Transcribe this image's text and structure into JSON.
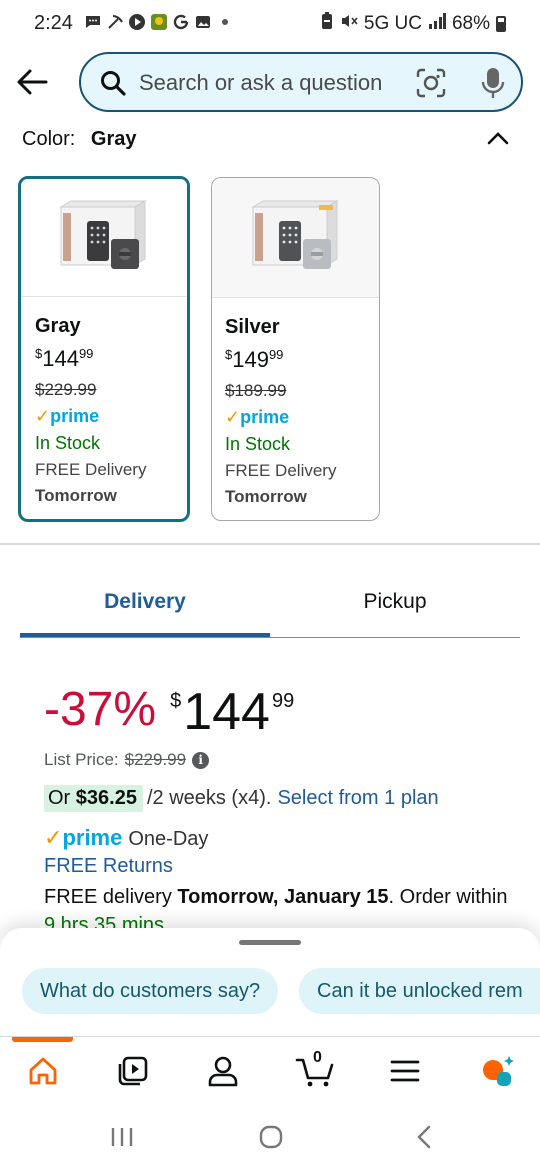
{
  "status_bar": {
    "time": "2:24",
    "network": "5G UC",
    "battery": "68%"
  },
  "search": {
    "placeholder": "Search or ask a question"
  },
  "color_selector": {
    "label": "Color:",
    "value": "Gray"
  },
  "swatches": [
    {
      "name": "Gray",
      "price_symbol": "$",
      "price_whole": "144",
      "price_fraction": "99",
      "list_price": "$229.99",
      "prime": "prime",
      "stock": "In Stock",
      "delivery": "FREE Delivery",
      "delivery_day": "Tomorrow"
    },
    {
      "name": "Silver",
      "price_symbol": "$",
      "price_whole": "149",
      "price_fraction": "99",
      "list_price": "$189.99",
      "prime": "prime",
      "stock": "In Stock",
      "delivery": "FREE Delivery",
      "delivery_day": "Tomorrow"
    }
  ],
  "tabs": [
    {
      "label": "Delivery",
      "active": true
    },
    {
      "label": "Pickup",
      "active": false
    }
  ],
  "pricing": {
    "discount": "-37%",
    "symbol": "$",
    "whole": "144",
    "fraction": "99",
    "list_label": "List Price:",
    "list_value": "$229.99",
    "installment_prefix": "Or",
    "installment_amount": "$36.25",
    "installment_terms": "/2 weeks (x4).",
    "installment_link": "Select from 1 plan"
  },
  "shipping": {
    "prime_label": "prime",
    "prime_speed": "One-Day",
    "returns": "FREE Returns",
    "delivery_prefix": "FREE delivery",
    "delivery_date": "Tomorrow, January 15",
    "delivery_suffix": ". Order",
    "order_within": "within",
    "countdown": "9 hrs 35 mins"
  },
  "ai_chips": [
    "What do customers say?",
    "Can it be unlocked rem"
  ],
  "bottom_nav": {
    "cart_count": "0",
    "active": "home",
    "accent": "#ff6200"
  },
  "colors": {
    "selected_border": "#147080",
    "link": "#1f5c99",
    "discount": "#cc0c39",
    "in_stock": "#007600",
    "prime": "#00a8e1"
  }
}
